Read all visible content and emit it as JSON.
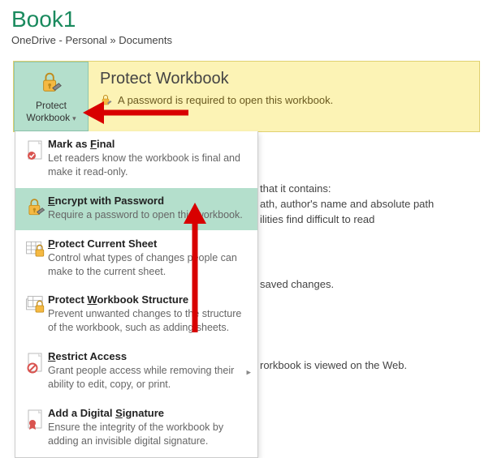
{
  "title": "Book1",
  "breadcrumb": "OneDrive - Personal » Documents",
  "banner": {
    "button_line1": "Protect",
    "button_line2": "Workbook",
    "title": "Protect Workbook",
    "desc": "A password is required to open this workbook."
  },
  "menu": {
    "final": {
      "title": "Mark as Final",
      "desc": "Let readers know the workbook is final and make it read-only."
    },
    "encrypt": {
      "title": "Encrypt with Password",
      "desc": "Require a password to open this workbook."
    },
    "sheet": {
      "title": "Protect Current Sheet",
      "desc": "Control what types of changes people can make to the current sheet."
    },
    "structure": {
      "title": "Protect Workbook Structure",
      "desc": "Prevent unwanted changes to the structure of the workbook, such as adding sheets."
    },
    "restrict": {
      "title": "Restrict Access",
      "desc": "Grant people access while removing their ability to edit, copy, or print."
    },
    "signature": {
      "title": "Add a Digital Signature",
      "desc": "Ensure the integrity of the workbook by adding an invisible digital signature."
    }
  },
  "bg": {
    "l1": " that it contains:",
    "l2": "ath, author's name and absolute path",
    "l3": "ilities find difficult to read",
    "l4": "saved changes.",
    "l5": "rorkbook is viewed on the Web."
  }
}
